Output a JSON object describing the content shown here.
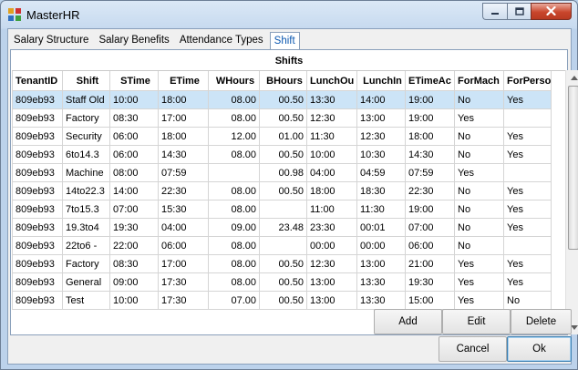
{
  "window": {
    "title": "MasterHR"
  },
  "tabs": [
    {
      "label": "Salary Structure"
    },
    {
      "label": "Salary Benefits"
    },
    {
      "label": "Attendance Types"
    },
    {
      "label": "Shift"
    }
  ],
  "grid": {
    "header": "Shifts",
    "columns": [
      "TenantID",
      "Shift",
      "STime",
      "ETime",
      "WHours",
      "BHours",
      "LunchOu",
      "LunchIn",
      "ETimeAc",
      "ForMach",
      "ForPerso"
    ],
    "rows": [
      [
        "809eb93",
        "Staff Old",
        "10:00",
        "18:00",
        "08.00",
        "00.50",
        "13:30",
        "14:00",
        "19:00",
        "No",
        "Yes"
      ],
      [
        "809eb93",
        "Factory",
        "08:30",
        "17:00",
        "08.00",
        "00.50",
        "12:30",
        "13:00",
        "19:00",
        "Yes",
        ""
      ],
      [
        "809eb93",
        "Security",
        "06:00",
        "18:00",
        "12.00",
        "01.00",
        "11:30",
        "12:30",
        "18:00",
        "No",
        "Yes"
      ],
      [
        "809eb93",
        "6to14.3",
        "06:00",
        "14:30",
        "08.00",
        "00.50",
        "10:00",
        "10:30",
        "14:30",
        "No",
        "Yes"
      ],
      [
        "809eb93",
        "Machine",
        "08:00",
        "07:59",
        "",
        "00.98",
        "04:00",
        "04:59",
        "07:59",
        "Yes",
        ""
      ],
      [
        "809eb93",
        "14to22.3",
        "14:00",
        "22:30",
        "08.00",
        "00.50",
        "18:00",
        "18:30",
        "22:30",
        "No",
        "Yes"
      ],
      [
        "809eb93",
        "7to15.3",
        "07:00",
        "15:30",
        "08.00",
        "",
        "11:00",
        "11:30",
        "19:00",
        "No",
        "Yes"
      ],
      [
        "809eb93",
        "19.3to4",
        "19:30",
        "04:00",
        "09.00",
        "23.48",
        "23:30",
        "00:01",
        "07:00",
        "No",
        "Yes"
      ],
      [
        "809eb93",
        "22to6 -",
        "22:00",
        "06:00",
        "08.00",
        "",
        "00:00",
        "00:00",
        "06:00",
        "No",
        ""
      ],
      [
        "809eb93",
        "Factory",
        "08:30",
        "17:00",
        "08.00",
        "00.50",
        "12:30",
        "13:00",
        "21:00",
        "Yes",
        "Yes"
      ],
      [
        "809eb93",
        "General",
        "09:00",
        "17:30",
        "08.00",
        "00.50",
        "13:00",
        "13:30",
        "19:30",
        "Yes",
        "Yes"
      ],
      [
        "809eb93",
        "Test",
        "10:00",
        "17:30",
        "07.00",
        "00.50",
        "13:00",
        "13:30",
        "15:00",
        "Yes",
        "No"
      ]
    ]
  },
  "buttons": {
    "add": "Add",
    "edit": "Edit",
    "delete": "Delete",
    "cancel": "Cancel",
    "ok": "Ok"
  }
}
